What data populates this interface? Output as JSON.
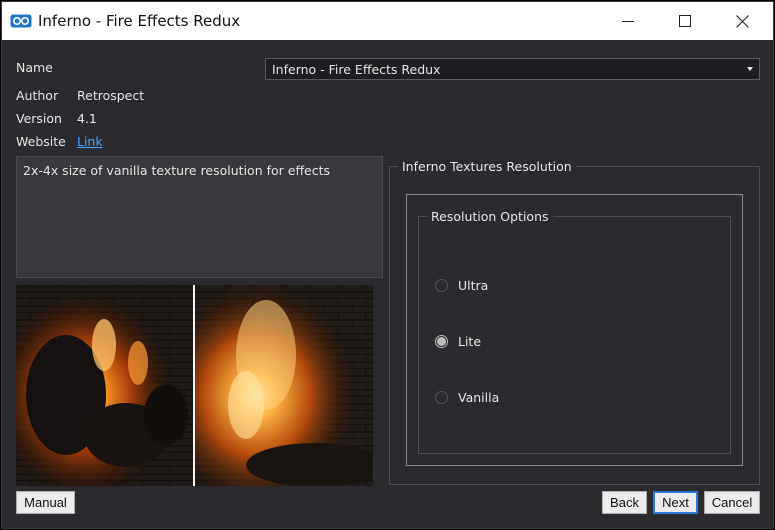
{
  "window": {
    "title": "Inferno - Fire Effects Redux"
  },
  "fields": {
    "name_label": "Name",
    "name_value": "Inferno - Fire Effects Redux",
    "author_label": "Author",
    "author_value": "Retrospect",
    "version_label": "Version",
    "version_value": "4.1",
    "website_label": "Website",
    "website_link": "Link"
  },
  "description": "2x-4x size of vanilla texture resolution for effects",
  "options": {
    "group_title": "Inferno Textures Resolution",
    "subgroup_title": "Resolution Options",
    "items": [
      {
        "label": "Ultra",
        "selected": false
      },
      {
        "label": "Lite",
        "selected": true
      },
      {
        "label": "Vanilla",
        "selected": false
      }
    ]
  },
  "buttons": {
    "manual": "Manual",
    "back": "Back",
    "next": "Next",
    "cancel": "Cancel"
  },
  "icons": {
    "app": "installer-logo-icon",
    "minimize": "minimize-icon",
    "maximize": "maximize-icon",
    "close": "close-icon"
  },
  "colors": {
    "background": "#2b2b2f",
    "link": "#4aa3ff",
    "accent": "#2b78d4"
  }
}
